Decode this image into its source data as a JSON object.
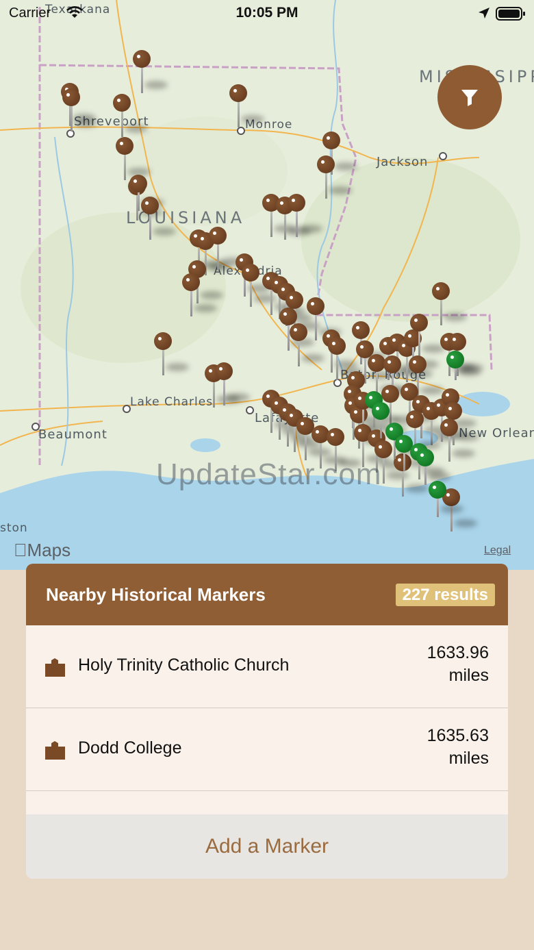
{
  "status_bar": {
    "carrier": "Carrier",
    "time": "10:05 PM"
  },
  "map": {
    "labels": {
      "texarkana": "Texarkana",
      "shreveport": "Shreveport",
      "monroe": "Monroe",
      "jackson": "Jackson",
      "mississippi": "MISSISSIPPI",
      "louisiana": "LOUISIANA",
      "alexandria": "Alexandria",
      "baton_rouge": "Baton Rouge",
      "lake_charles": "Lake Charles",
      "lafayette": "Lafayette",
      "beaumont": "Beaumont",
      "new_orleans": "New Orleans",
      "houston": "ston"
    },
    "watermark": "UpdateStar.com",
    "maps_logo": "Maps",
    "legal": "Legal",
    "filter_icon": "filter-icon",
    "colors": {
      "pin": "#6a3f22",
      "pin_selected": "#137a25",
      "accent": "#8f5e34"
    }
  },
  "panel": {
    "title": "Nearby Historical Markers",
    "results": "227 results",
    "items": [
      {
        "name": "Holy Trinity Catholic Church",
        "distance_value": "1633.96",
        "distance_unit": "miles",
        "icon": "church-marker-icon"
      },
      {
        "name": "Dodd College",
        "distance_value": "1635.63",
        "distance_unit": "miles",
        "icon": "church-marker-icon"
      }
    ],
    "add_button": "Add a Marker"
  }
}
